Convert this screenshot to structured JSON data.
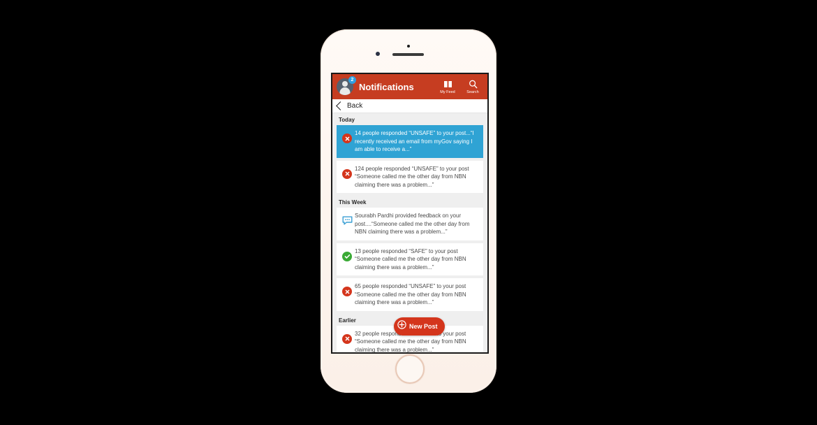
{
  "app": {
    "title": "Notifications",
    "avatar_badge": "2",
    "avatar_icon": "user-avatar-icon",
    "actions": [
      {
        "label": "My Feed",
        "icon": "book-icon"
      },
      {
        "label": "Search",
        "icon": "search-icon"
      }
    ],
    "back_label": "Back",
    "new_post_label": "New Post"
  },
  "colors": {
    "header_red": "#c63d21",
    "selected_blue": "#2fa3d4",
    "unsafe_red": "#d4351c",
    "safe_green": "#3aaa35",
    "feedback_blue": "#3a9fd4",
    "screen_bg": "#efefef"
  },
  "sections": [
    {
      "title": "Today",
      "items": [
        {
          "icon": "unsafe-x-icon",
          "type": "unsafe",
          "selected": true,
          "text": "14 people responded “UNSAFE” to your post...“I recently received an email from myGov saying I am able to receive a...”"
        },
        {
          "icon": "unsafe-x-icon",
          "type": "unsafe",
          "selected": false,
          "text": "124 people responded “UNSAFE” to your post “Someone called me the other day from NBN claiming there was a problem...”"
        }
      ]
    },
    {
      "title": "This Week",
      "items": [
        {
          "icon": "comment-bubble-icon",
          "type": "feedback",
          "selected": false,
          "text": "Sourabh Pardhi provided feedback on your post....“Someone called me the other day from NBN claiming there was a problem...”"
        },
        {
          "icon": "safe-check-icon",
          "type": "safe",
          "selected": false,
          "text": "13 people responded “SAFE” to your post “Someone called me the other day from NBN claiming there was a problem...”"
        },
        {
          "icon": "unsafe-x-icon",
          "type": "unsafe",
          "selected": false,
          "text": "65 people responded “UNSAFE” to your post “Someone called me the other day from NBN claiming there was a problem...”"
        }
      ]
    },
    {
      "title": "Earlier",
      "items": [
        {
          "icon": "unsafe-x-icon",
          "type": "unsafe",
          "selected": false,
          "text": "32 people responded “UNSAFE” to your post “Someone called me the other day from NBN claiming there was a problem...”"
        }
      ]
    }
  ]
}
